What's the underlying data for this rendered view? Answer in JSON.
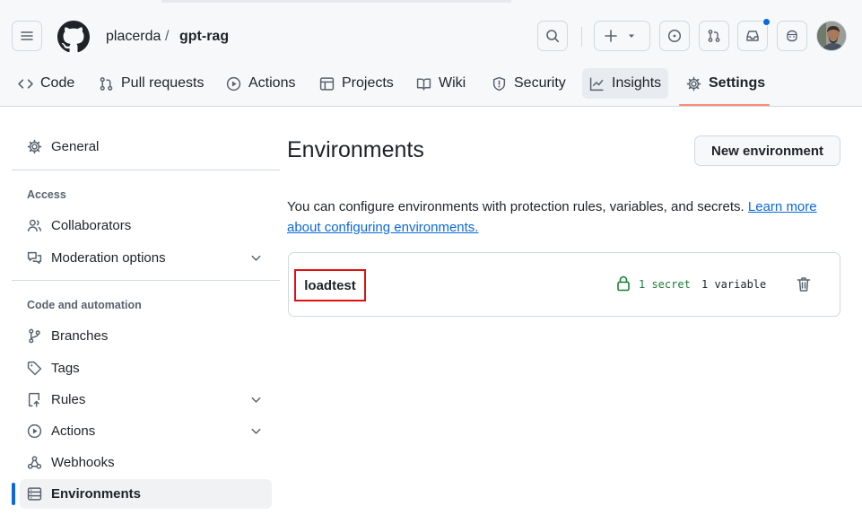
{
  "repo": {
    "owner": "placerda",
    "separator": "/",
    "name": "gpt-rag"
  },
  "tabs": [
    {
      "label": "Code",
      "icon": "code-icon"
    },
    {
      "label": "Pull requests",
      "icon": "git-pull-request-icon"
    },
    {
      "label": "Actions",
      "icon": "play-icon"
    },
    {
      "label": "Projects",
      "icon": "table-icon"
    },
    {
      "label": "Wiki",
      "icon": "book-icon"
    },
    {
      "label": "Security",
      "icon": "shield-icon"
    },
    {
      "label": "Insights",
      "icon": "graph-icon"
    },
    {
      "label": "Settings",
      "icon": "gear-icon"
    }
  ],
  "sidebar": {
    "general": "General",
    "access_heading": "Access",
    "collaborators": "Collaborators",
    "moderation": "Moderation options",
    "code_heading": "Code and automation",
    "branches": "Branches",
    "tags": "Tags",
    "rules": "Rules",
    "actions": "Actions",
    "webhooks": "Webhooks",
    "environments": "Environments"
  },
  "main": {
    "title": "Environments",
    "new_button": "New environment",
    "description": "You can configure environments with protection rules, variables, and secrets.",
    "learn_more": "Learn more about configuring environments.",
    "environments": [
      {
        "name": "loadtest",
        "secrets": "1 secret",
        "variables": "1 variable"
      }
    ]
  },
  "colors": {
    "accent": "#0969da",
    "tab_underline": "#fd8c73",
    "highlight_box": "#e01010",
    "secret_green": "#1a7f37"
  }
}
